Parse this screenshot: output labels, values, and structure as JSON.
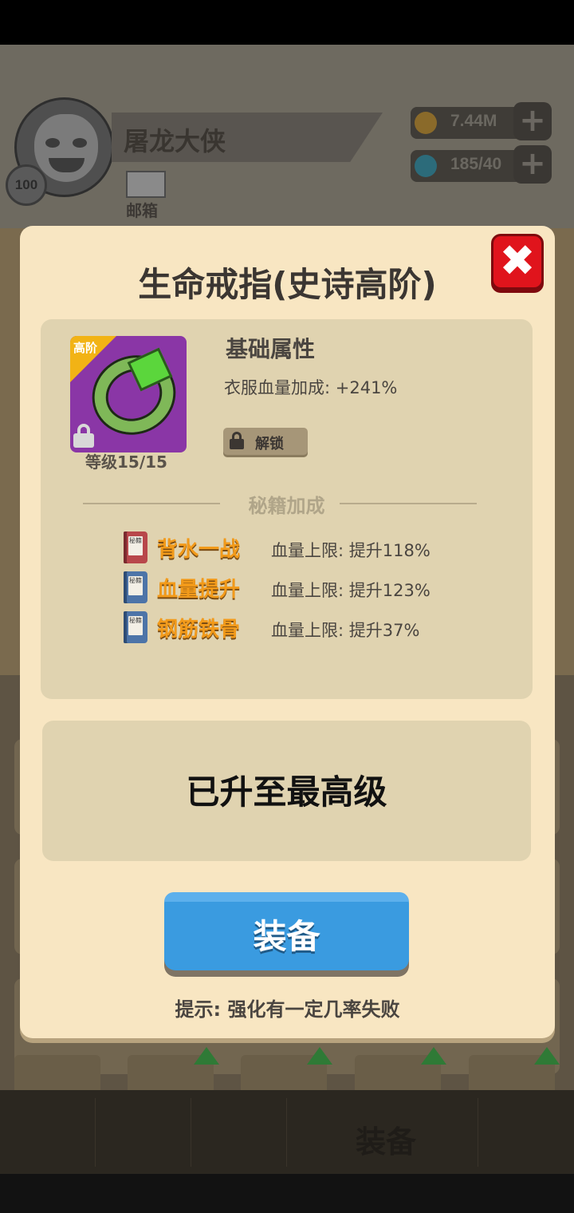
{
  "background": {
    "player_name": "屠龙大侠",
    "player_level": "100",
    "mail_label": "邮箱",
    "gold": "7.44M",
    "gems": "185/40",
    "nav_active_label": "装备"
  },
  "dialog": {
    "title": "生命戒指(史诗高阶)",
    "item": {
      "tier_badge": "高阶",
      "level": "等级15/15"
    },
    "base_attributes": {
      "title": "基础属性",
      "line": "衣服血量加成: +241%",
      "unlock_label": "解锁"
    },
    "secret_section_title": "秘籍加成",
    "book_glyph": "秘籍",
    "skills": [
      {
        "name": "背水一战",
        "effect": "血量上限: 提升118%",
        "book_color": "red"
      },
      {
        "name": "血量提升",
        "effect": "血量上限: 提升123%",
        "book_color": "blue"
      },
      {
        "name": "钢筋铁骨",
        "effect": "血量上限: 提升37%",
        "book_color": "blue"
      }
    ],
    "maxed_text": "已升至最高级",
    "equip_label": "装备",
    "hint": "提示: 强化有一定几率失败"
  },
  "colors": {
    "dialog_bg": "#f8e6c2",
    "panel_bg": "#e0d3b0",
    "accent_orange": "#f29a1a",
    "button_blue": "#3a9be0",
    "close_red": "#e0141c"
  }
}
